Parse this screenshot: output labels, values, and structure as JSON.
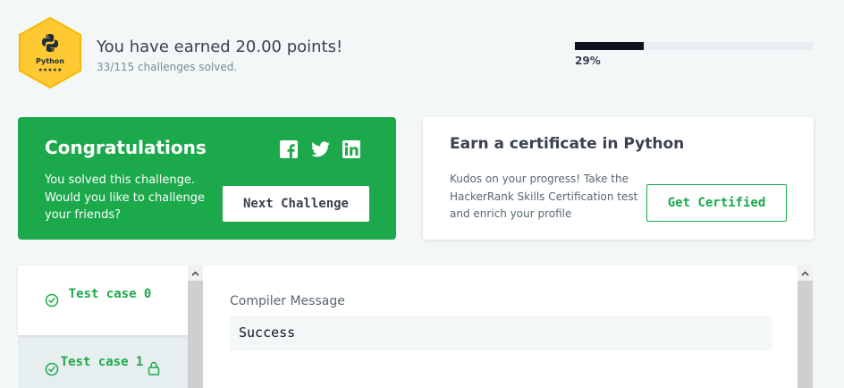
{
  "badge": {
    "language": "Python",
    "stars": "★★★★★",
    "icon": "python-logo-icon",
    "color": "#ffc933"
  },
  "points": {
    "earned_text": "You have earned 20.00 points!",
    "solved_text": "33/115 challenges solved."
  },
  "progress": {
    "percent_label": "29%",
    "fraction": 0.29
  },
  "congrats": {
    "title": "Congratulations",
    "text": "You solved this challenge. Would you like to challenge your friends?",
    "social": [
      "facebook-icon",
      "twitter-icon",
      "linkedin-icon"
    ],
    "button": "Next Challenge",
    "color": "#1ba94c"
  },
  "certificate": {
    "title": "Earn a certificate in Python",
    "text": "Kudos on your progress! Take the HackerRank Skills Certification test and enrich your profile",
    "button": "Get Certified"
  },
  "test_cases": [
    {
      "label": "Test case 0",
      "status": "passed",
      "locked": false
    },
    {
      "label": "Test case 1",
      "status": "passed",
      "locked": true
    }
  ],
  "compiler": {
    "label": "Compiler Message",
    "value": "Success"
  }
}
